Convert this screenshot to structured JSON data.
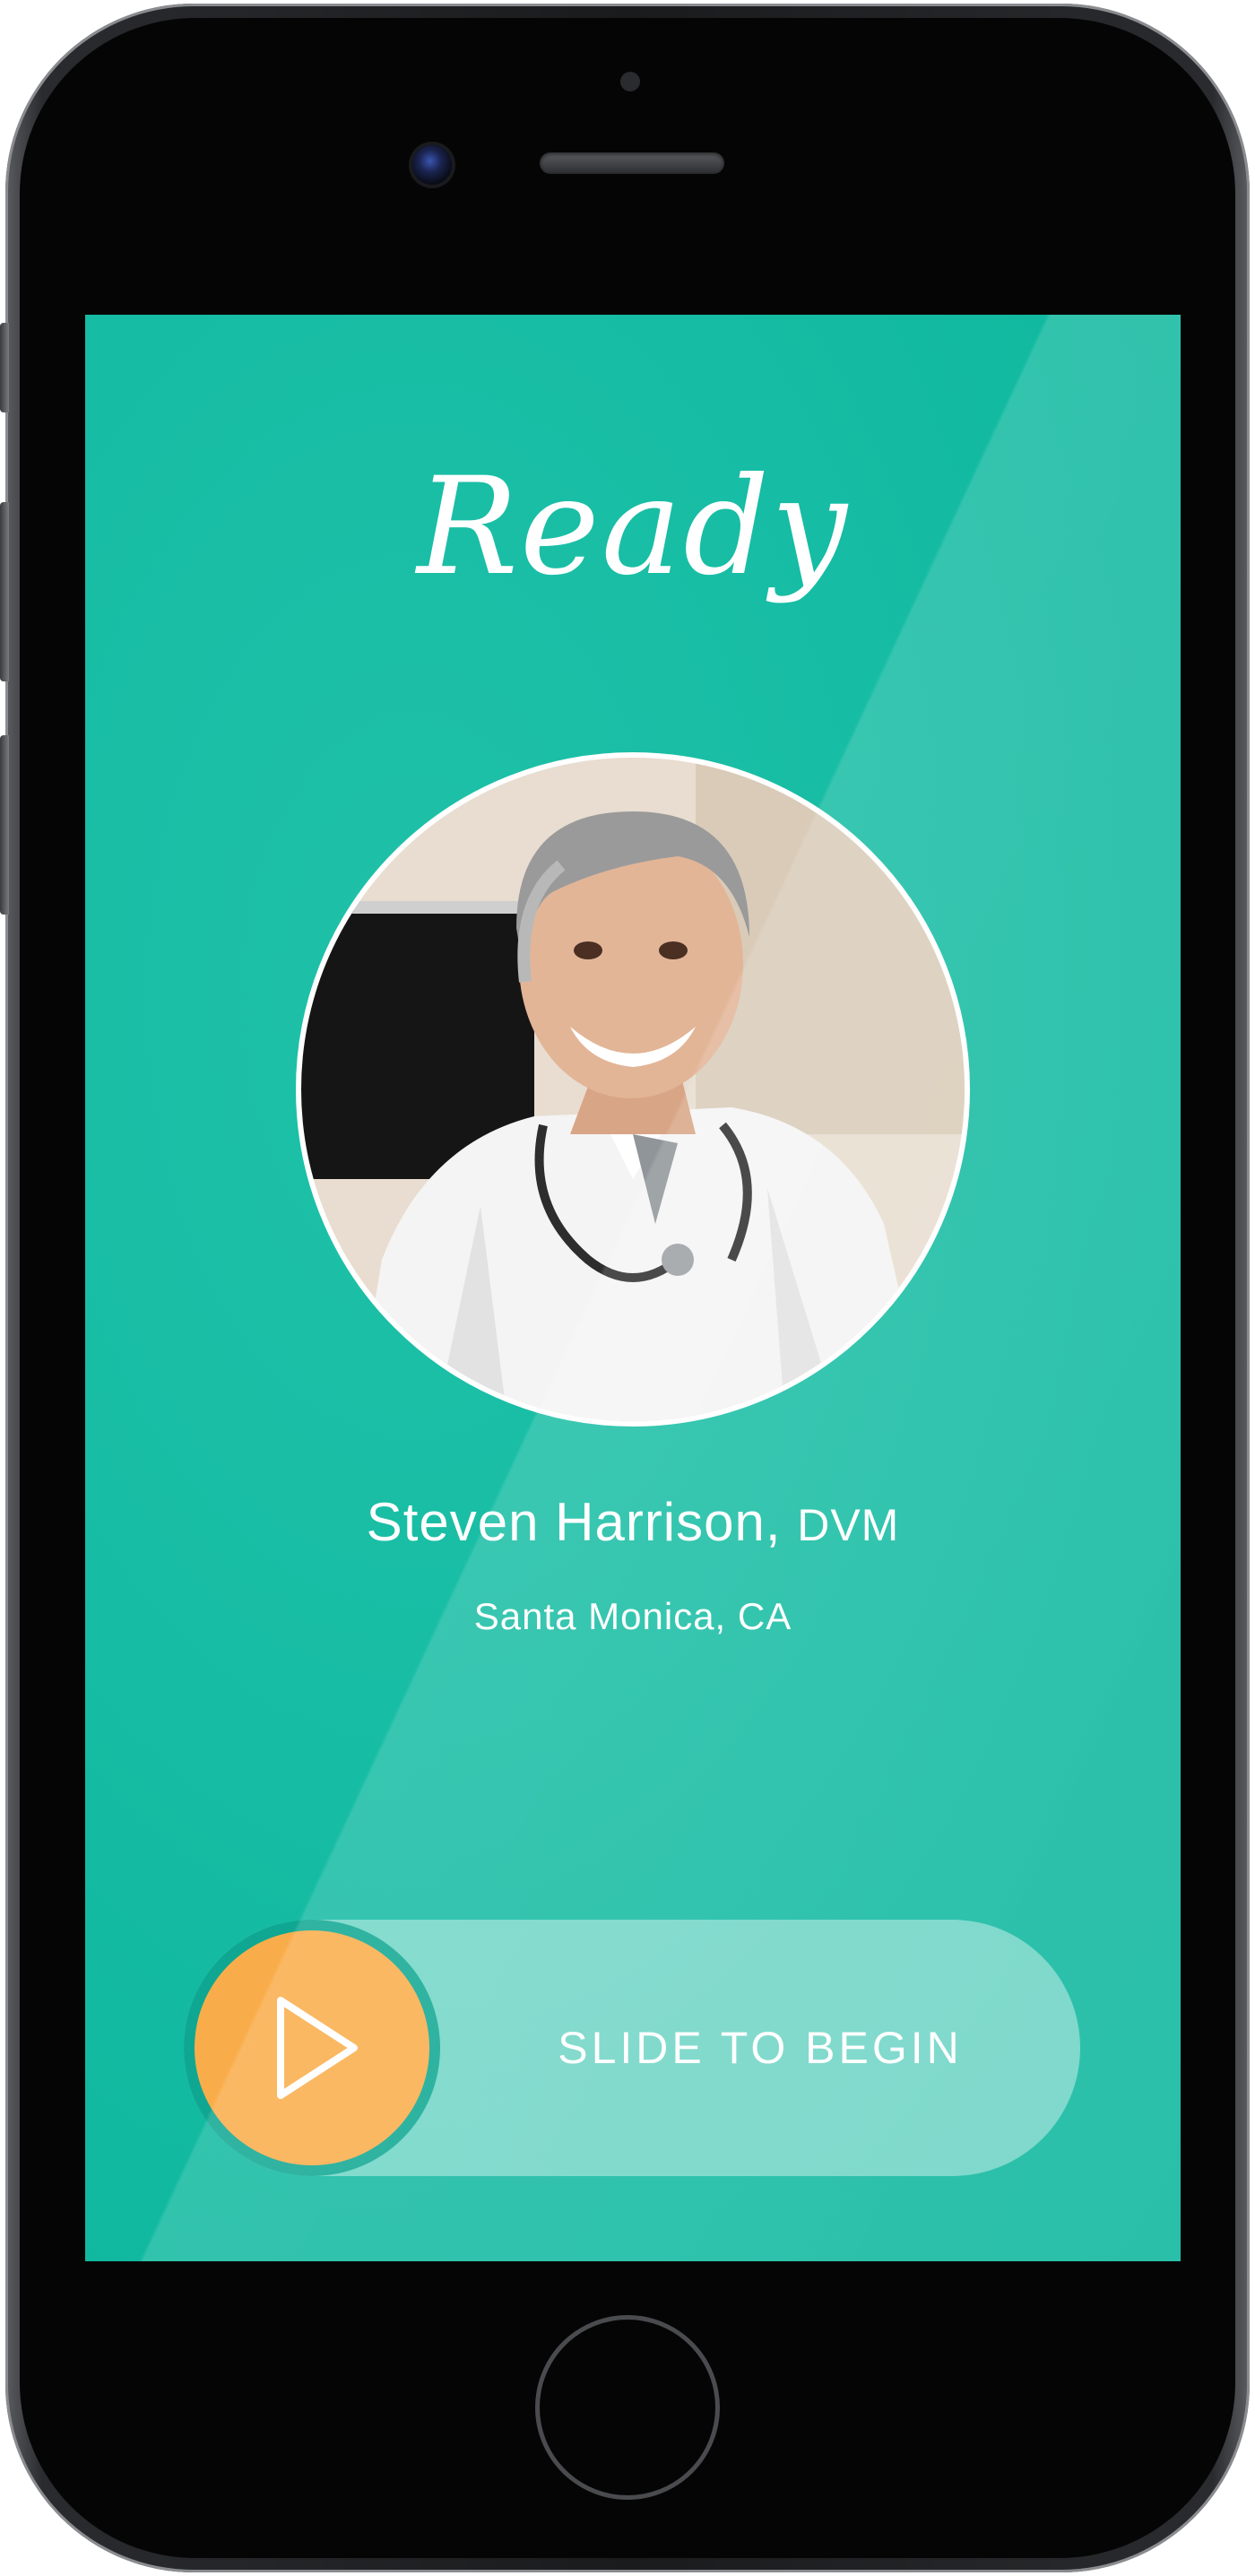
{
  "screen": {
    "title": "Ready",
    "doctor": {
      "name": "Steven Harrison,",
      "credential": "DVM",
      "location": "Santa Monica, CA"
    },
    "slider": {
      "label": "SLIDE TO BEGIN",
      "knob_icon": "play-icon"
    }
  },
  "colors": {
    "background": "#14bca3",
    "knob": "#f9ad4a",
    "text": "#ffffff"
  }
}
